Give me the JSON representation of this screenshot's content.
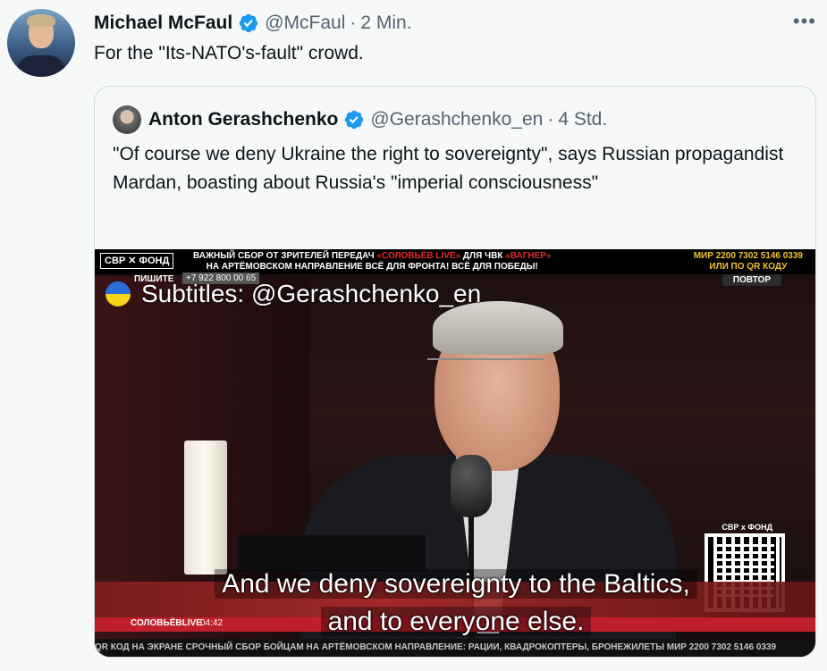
{
  "tweet": {
    "author_name": "Michael McFaul",
    "author_handle": "@McFaul",
    "separator": "·",
    "time": "2 Min.",
    "more_label": "•••",
    "text": "For the \"Its-NATO's-fault\" crowd."
  },
  "quote": {
    "author_name": "Anton Gerashchenko",
    "author_handle": "@Gerashchenko_en",
    "separator": "·",
    "time": "4 Std.",
    "text": "\"Of course we deny Ukraine the right to sovereignty\", says Russian propagandist Mardan, boasting about Russia's \"imperial consciousness\""
  },
  "video": {
    "logo": "СВР ✕ ФОНД",
    "ticker_line1_a": "ВАЖНЫЙ  СБОР ОТ ЗРИТЕЛЕЙ ПЕРЕДАЧ ",
    "ticker_line1_red": "«СОЛОВЬЁВ LIVE»",
    "ticker_line1_b": " ДЛЯ ЧВК ",
    "ticker_line1_red2": "«ВАГНЕР»",
    "ticker_line2": "НА АРТЁМОВСКОМ НАПРАВЛЕНИЕ  ВСЁ ДЛЯ ФРОНТА! ВСЁ ДЛЯ ПОБЕДЫ!",
    "mir_line1": "МИР 2200 7302 5146 0339",
    "mir_line2": "ИЛИ ПО QR КОДУ",
    "povtor": "ПОВТОР",
    "write_label": "ПИШИТЕ",
    "phone": "+7 922 800 00 65",
    "subtitle_credit": "Subtitles: @Gerashchenko_en",
    "qr_label": "СВР х ФОНД",
    "lower_tag": "СОЛОВЬЁВLIVE",
    "lower_time": "04:42",
    "caption_line1": "And we deny sovereignty to the Baltics,",
    "caption_line2": "and to everyone else.",
    "bottom_ticker": "QR КОД НА ЭКРАНЕ     СРОЧНЫЙ СБОР БОЙЦАМ НА АРТЁМОВСКОМ НАПРАВЛЕНИЕ: РАЦИИ, КВАДРОКОПТЕРЫ, БРОНЕЖИЛЕТЫ     МИР 2200 7302 5146 0339"
  },
  "colors": {
    "verified": "#1d9bf0",
    "text_secondary": "#536471",
    "background": "#f7f9f9"
  }
}
